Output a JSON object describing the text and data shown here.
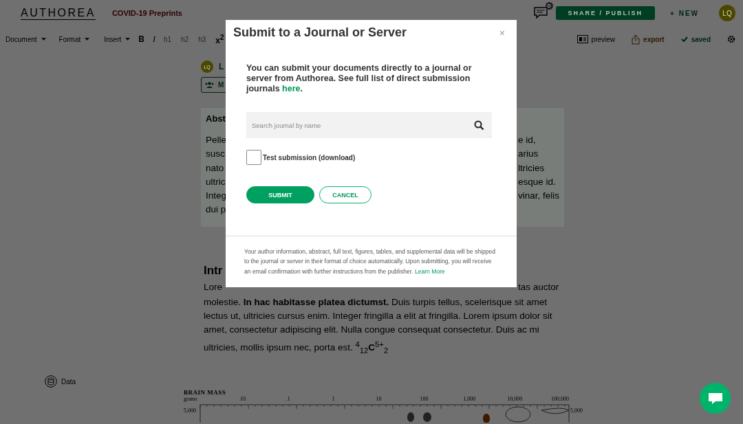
{
  "header": {
    "logo": "AUTHOREA",
    "collection": "COVID-19 Preprints",
    "comment_count": "0",
    "share_button": "SHARE / PUBLISH",
    "new_button": "+ NEW",
    "avatar": "LQ"
  },
  "toolbar": {
    "items": [
      {
        "kind": "menu",
        "label": "Document",
        "disabled": false
      },
      {
        "kind": "menu",
        "label": "Format",
        "disabled": false
      },
      {
        "kind": "menu",
        "label": "Insert",
        "disabled": false
      },
      {
        "kind": "bold",
        "label": "B",
        "disabled": false
      },
      {
        "kind": "italic",
        "label": "I",
        "disabled": false
      },
      {
        "kind": "heading",
        "label": "h1",
        "disabled": true
      },
      {
        "kind": "heading",
        "label": "h2",
        "disabled": true
      },
      {
        "kind": "heading",
        "label": "h3",
        "disabled": true
      },
      {
        "kind": "superscript",
        "label": "x$^{2}$",
        "disabled": false
      }
    ],
    "actions": [
      {
        "kind": "preview",
        "label": "preview"
      },
      {
        "kind": "export",
        "label": "export"
      },
      {
        "kind": "saved",
        "label": "saved"
      }
    ]
  },
  "sidebar": {
    "data_label": "Data"
  },
  "document": {
    "author_avatar": "LQ",
    "author_name": "L",
    "members_button": "M",
    "abstract": {
      "title": "Abst",
      "lines": [
        {
          "left": "Pelle",
          "right": "e id,"
        },
        {
          "left": "susc",
          "right": "arius"
        },
        {
          "left": "nato",
          "right": "ltricies"
        },
        {
          "left": "ultric",
          "right": "esque id."
        },
        {
          "left": "Integ",
          "right": "vinar, felis"
        },
        {
          "left": "dui p"
        }
      ]
    },
    "intro": {
      "title": "Intr",
      "first_left": "Lore",
      "first_right": "tas auctor",
      "paragraph": "molestie. **In hac habitasse platea dictumst.** Duis turpis tellus, scelerisque sit amet lectus ut, ultricies cursus enim. Integer fringilla a elit at fringilla. Lorem ipsum dolor sit amet, consectetur adipiscing elit. Nulla congue consequat consectetur. Duis ac mi ultricies, mollis ipsum nec, porta est. $^{4}$$_{12}$**C**$^{5+}$$_{2}$"
    },
    "figure": {
      "title": "BRAIN MASS",
      "unit": "grams",
      "ticks": [
        ".01",
        ".1",
        "1",
        "10",
        "100",
        "1,000",
        "10,000",
        "100,000"
      ],
      "left_value": "5,000",
      "right_value": "5,000"
    }
  },
  "modal": {
    "title": "Submit to a Journal or Server",
    "close": "×",
    "intro": "You can submit your documents directly to a journal or server from Authorea. See full list of direct submission journals ",
    "intro_link": "here",
    "intro_end": ".",
    "search": {
      "placeholder": "Search journal by name"
    },
    "test_submission": {
      "label": "Test submission (download)",
      "checked": false
    },
    "submit": "SUBMIT",
    "cancel": "CANCEL",
    "footer": "Your author information, abstract, full text, figures, tables, and supplemental data will be shipped to the journal or server in their format of choice automatically. Upon submitting, you will receive an email confirmation with further instructions from the publisher. ",
    "footer_link": "Learn More"
  }
}
